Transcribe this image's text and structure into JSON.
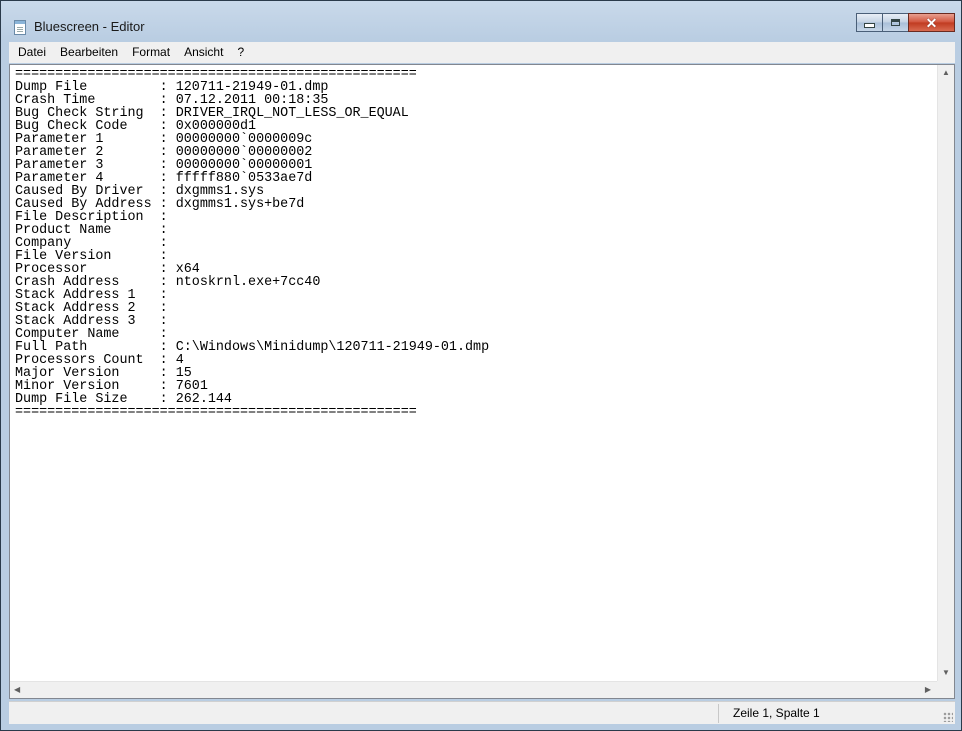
{
  "window": {
    "title": "Bluescreen - Editor",
    "icon": "notepad-icon",
    "controls": {
      "minimize": "minimize-icon",
      "maximize": "maximize-icon",
      "close": "close-icon"
    }
  },
  "menu": {
    "items": [
      "Datei",
      "Bearbeiten",
      "Format",
      "Ansicht",
      "?"
    ]
  },
  "editor": {
    "content": "==================================================\nDump File         : 120711-21949-01.dmp\nCrash Time        : 07.12.2011 00:18:35\nBug Check String  : DRIVER_IRQL_NOT_LESS_OR_EQUAL\nBug Check Code    : 0x000000d1\nParameter 1       : 00000000`0000009c\nParameter 2       : 00000000`00000002\nParameter 3       : 00000000`00000001\nParameter 4       : fffff880`0533ae7d\nCaused By Driver  : dxgmms1.sys\nCaused By Address : dxgmms1.sys+be7d\nFile Description  : \nProduct Name      : \nCompany           : \nFile Version      : \nProcessor         : x64\nCrash Address     : ntoskrnl.exe+7cc40\nStack Address 1   : \nStack Address 2   : \nStack Address 3   : \nComputer Name     : \nFull Path         : C:\\Windows\\Minidump\\120711-21949-01.dmp\nProcessors Count  : 4\nMajor Version     : 15\nMinor Version     : 7601\nDump File Size    : 262.144\n=================================================="
  },
  "statusbar": {
    "position": "Zeile 1, Spalte 1"
  }
}
